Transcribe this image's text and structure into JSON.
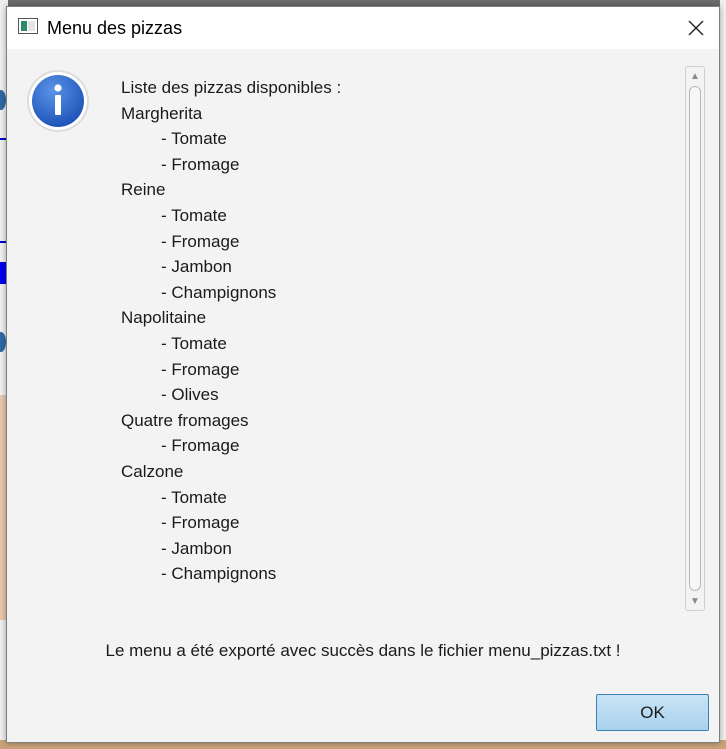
{
  "window": {
    "title": "Menu des pizzas"
  },
  "icons": {
    "app": "application-icon",
    "info": "info-icon",
    "close": "close-icon"
  },
  "content": {
    "lines": [
      {
        "text": "Liste des pizzas disponibles :",
        "indent": false
      },
      {
        "text": "Margherita",
        "indent": false
      },
      {
        "text": "- Tomate",
        "indent": true
      },
      {
        "text": "- Fromage",
        "indent": true
      },
      {
        "text": "Reine",
        "indent": false
      },
      {
        "text": "- Tomate",
        "indent": true
      },
      {
        "text": "- Fromage",
        "indent": true
      },
      {
        "text": "- Jambon",
        "indent": true
      },
      {
        "text": "- Champignons",
        "indent": true
      },
      {
        "text": "Napolitaine",
        "indent": false
      },
      {
        "text": "- Tomate",
        "indent": true
      },
      {
        "text": "- Fromage",
        "indent": true
      },
      {
        "text": "- Olives",
        "indent": true
      },
      {
        "text": "Quatre fromages",
        "indent": false
      },
      {
        "text": "- Fromage",
        "indent": true
      },
      {
        "text": "Calzone",
        "indent": false
      },
      {
        "text": "- Tomate",
        "indent": true
      },
      {
        "text": "- Fromage",
        "indent": true
      },
      {
        "text": "- Jambon",
        "indent": true
      },
      {
        "text": "- Champignons",
        "indent": true
      }
    ]
  },
  "message": "Le menu a été exporté avec succès dans le fichier menu_pizzas.txt !",
  "buttons": {
    "ok_label": "OK"
  },
  "colors": {
    "accent": "#3c7fb1",
    "info_blue": "#2f6fd0"
  }
}
